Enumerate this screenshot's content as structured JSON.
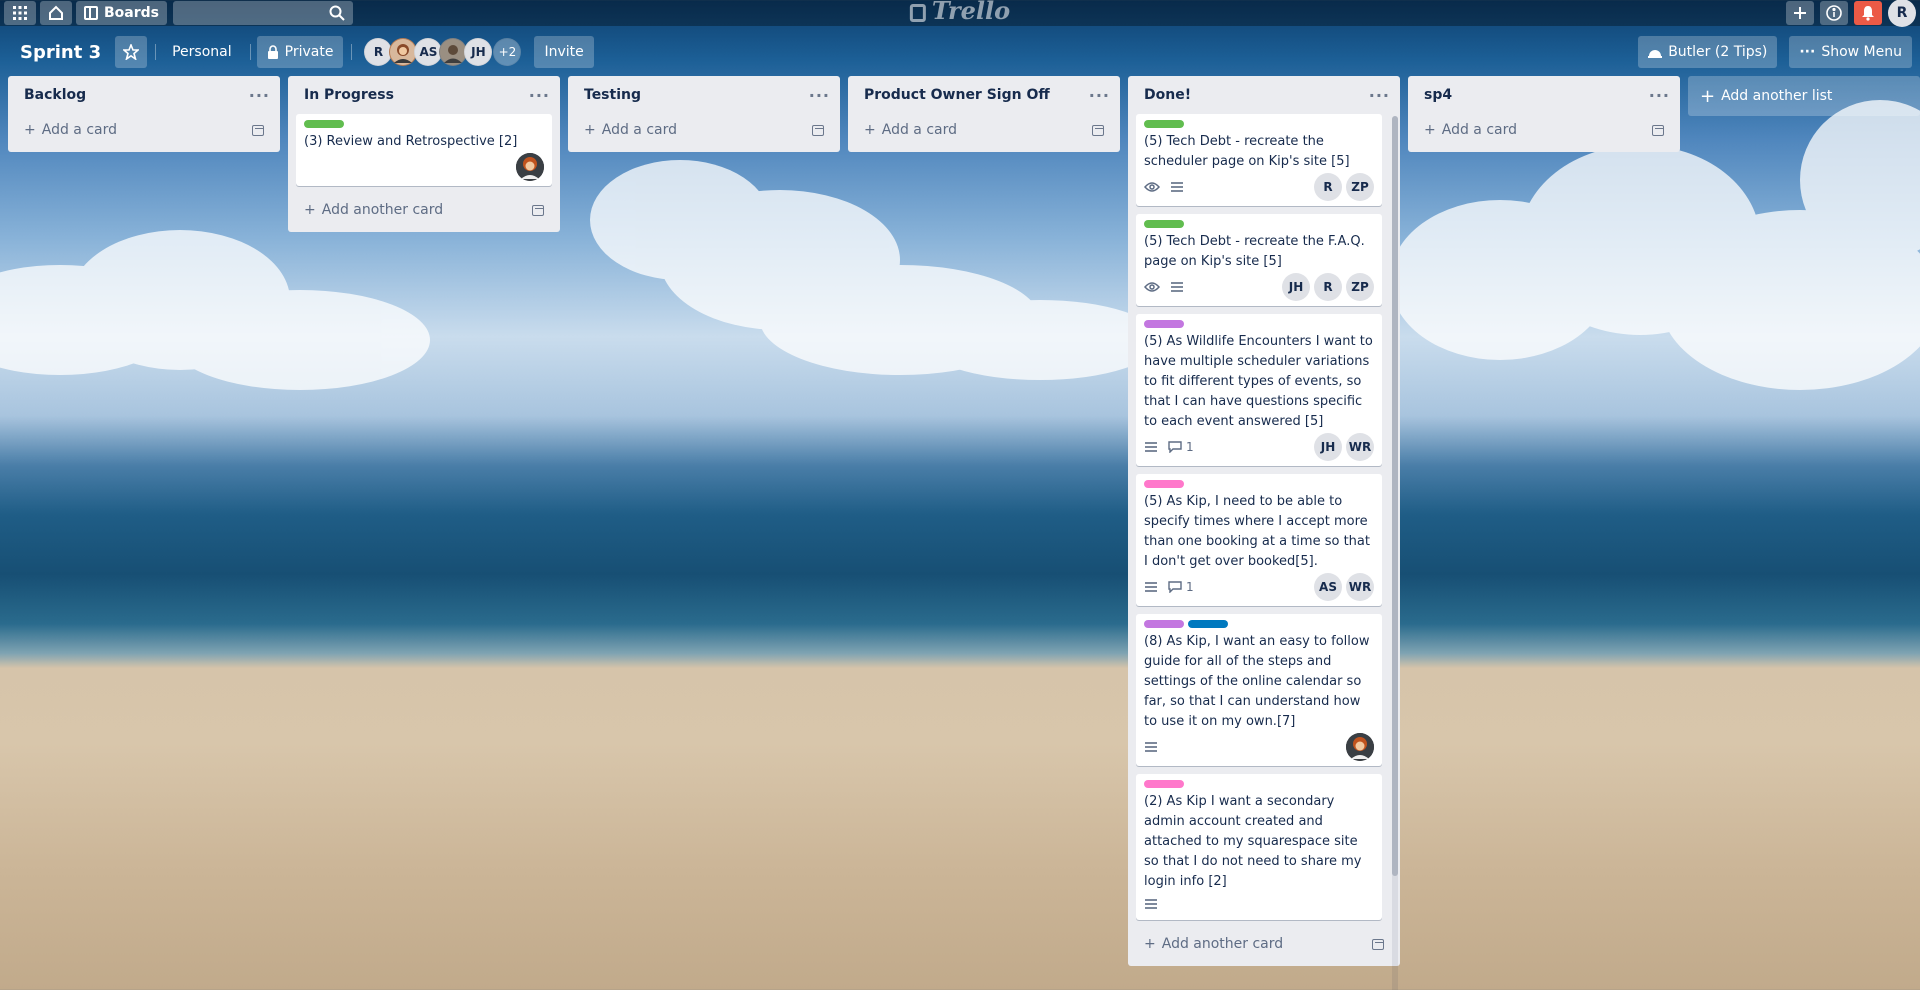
{
  "topbar": {
    "apps_icon": "grid-icon",
    "home_icon": "home-icon",
    "boards_label": "Boards",
    "search_placeholder": "",
    "logo_text": "Trello",
    "user_initial": "R"
  },
  "board": {
    "title": "Sprint 3",
    "team_label": "Personal",
    "visibility_label": "Private",
    "members": [
      "R",
      "",
      "AS",
      "",
      "JH"
    ],
    "more_members": "+2",
    "invite_label": "Invite",
    "butler_label": "Butler (2 Tips)",
    "menu_label": "Show Menu"
  },
  "add_list_label": "Add another list",
  "lists": [
    {
      "title": "Backlog",
      "add_label": "Add a card",
      "cards": []
    },
    {
      "title": "In Progress",
      "add_label": "Add another card",
      "cards": [
        {
          "labels": [
            "#61bd4f"
          ],
          "title": "(3) Review and Retrospective [2]",
          "members": [
            "avatar"
          ]
        }
      ]
    },
    {
      "title": "Testing",
      "add_label": "Add a card",
      "cards": []
    },
    {
      "title": "Product Owner Sign Off",
      "add_label": "Add a card",
      "cards": []
    },
    {
      "title": "Done!",
      "add_label": "Add another card",
      "cards": [
        {
          "labels": [
            "#61bd4f"
          ],
          "title": "(5) Tech Debt - recreate the scheduler page on Kip's site [5]",
          "watch": true,
          "description": true,
          "members": [
            "R",
            "ZP"
          ]
        },
        {
          "labels": [
            "#61bd4f"
          ],
          "title": "(5) Tech Debt - recreate the F.A.Q. page on Kip's site [5]",
          "watch": true,
          "description": true,
          "members": [
            "JH",
            "R",
            "ZP"
          ]
        },
        {
          "labels": [
            "#c377e0"
          ],
          "title": "(5) As Wildlife Encounters I want to have multiple scheduler variations to fit different types of events, so that I can have questions specific to each event answered [5]",
          "description": true,
          "comments": "1",
          "members": [
            "JH",
            "WR"
          ]
        },
        {
          "labels": [
            "#ff78cb"
          ],
          "title": "(5) As Kip, I need to be able to specify times where I accept more than one booking at a time so that I don't get over booked[5].",
          "description": true,
          "comments": "1",
          "members": [
            "AS",
            "WR"
          ]
        },
        {
          "labels": [
            "#c377e0",
            "#0079bf"
          ],
          "title": "(8) As Kip, I want an easy to follow guide for all of the steps and settings of the online calendar so far, so that I can understand how to use it on my own.[7]",
          "description": true,
          "members": [
            "avatar"
          ]
        },
        {
          "labels": [
            "#ff78cb"
          ],
          "title": "(2) As Kip I want a secondary admin account created and attached to my squarespace site so that I do not need to share my login info [2]",
          "description": true,
          "members": []
        }
      ]
    },
    {
      "title": "sp4",
      "add_label": "Add a card",
      "cards": []
    }
  ]
}
